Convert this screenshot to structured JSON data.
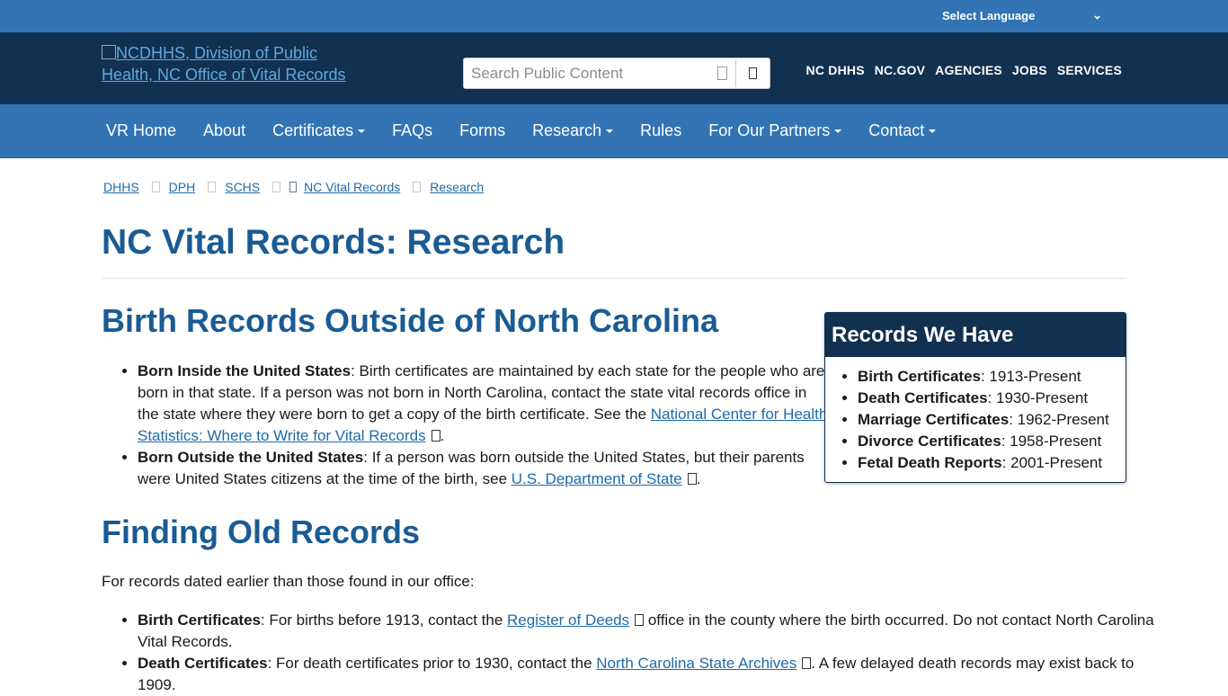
{
  "language_bar": {
    "label": "Select Language"
  },
  "header": {
    "logo_alt": "NCDHHS, Division of Public Health, NC Office of Vital Records",
    "search_placeholder": "Search Public Content",
    "top_links": [
      "NC DHHS",
      "NC.GOV",
      "AGENCIES",
      "JOBS",
      "SERVICES"
    ]
  },
  "nav": {
    "items": [
      {
        "label": "VR Home",
        "dropdown": false
      },
      {
        "label": "About",
        "dropdown": false
      },
      {
        "label": "Certificates",
        "dropdown": true
      },
      {
        "label": "FAQs",
        "dropdown": false
      },
      {
        "label": "Forms",
        "dropdown": false
      },
      {
        "label": "Research",
        "dropdown": true
      },
      {
        "label": "Rules",
        "dropdown": false
      },
      {
        "label": "For Our Partners",
        "dropdown": true
      },
      {
        "label": "Contact",
        "dropdown": true
      }
    ]
  },
  "breadcrumb": [
    "DHHS",
    "DPH",
    "SCHS",
    "NC Vital Records",
    "Research"
  ],
  "page_title": "NC Vital Records: Research",
  "birth_section": {
    "heading": "Birth Records Outside of North Carolina",
    "inside": {
      "term": "Born Inside the United States",
      "text": ": Birth certificates are maintained by each state for the people who are born in that state. If a person was not born in North Carolina, contact the state vital records office in the state where they were born to get a copy of the birth certificate. See the ",
      "link": "National Center for Health Statistics: Where to Write for Vital Records",
      "after": "."
    },
    "outside": {
      "term": "Born Outside the United States",
      "text": ": If a person was born outside the United States, but their parents were United States citizens at the time of the birth, see ",
      "link": "U.S. Department of State",
      "after": "."
    }
  },
  "sidebar": {
    "heading": "Records We Have",
    "items": [
      {
        "term": "Birth Certificates",
        "value": ": 1913-Present"
      },
      {
        "term": "Death Certificates",
        "value": ": 1930-Present"
      },
      {
        "term": "Marriage Certificates",
        "value": ": 1962-Present"
      },
      {
        "term": "Divorce Certificates",
        "value": ": 1958-Present"
      },
      {
        "term": "Fetal Death Reports",
        "value": ": 2001-Present"
      }
    ]
  },
  "old_section": {
    "heading": "Finding Old Records",
    "intro": "For records dated earlier than those found in our office:",
    "birth": {
      "term": "Birth Certificates",
      "text": ": For births before 1913, contact the ",
      "link": "Register of Deeds",
      "after": " office in the county where the birth occurred. Do not contact North Carolina Vital Records."
    },
    "death": {
      "term": "Death Certificates",
      "text": ": For death certificates prior to 1930, contact the ",
      "link": "North Carolina State Archives",
      "after": ". A few delayed death records may exist back to 1909."
    }
  }
}
